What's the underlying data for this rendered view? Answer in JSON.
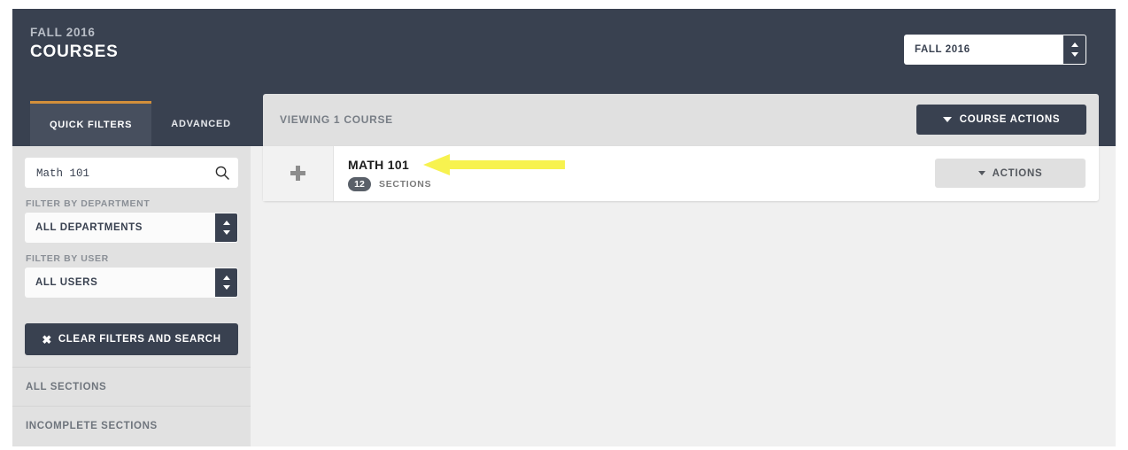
{
  "header": {
    "term_eyebrow": "FALL 2016",
    "page_title": "COURSES",
    "term_select": {
      "value": "FALL 2016",
      "stepper_icon": "stepper-updown-icon"
    },
    "tabs": [
      {
        "label": "QUICK FILTERS",
        "active": true
      },
      {
        "label": "ADVANCED",
        "active": false
      }
    ],
    "accent_color": "#d38f3b",
    "background_color": "#394150"
  },
  "sidebar": {
    "search": {
      "value": "Math 101",
      "placeholder": "Search",
      "icon": "search-icon"
    },
    "department_filter": {
      "label": "FILTER BY DEPARTMENT",
      "value": "ALL DEPARTMENTS"
    },
    "user_filter": {
      "label": "FILTER BY USER",
      "value": "ALL USERS"
    },
    "clear_button": {
      "label": "CLEAR FILTERS AND SEARCH",
      "icon": "close-x-icon",
      "icon_glyph": "✖"
    },
    "items": [
      {
        "label": "ALL SECTIONS"
      },
      {
        "label": "INCOMPLETE SECTIONS"
      }
    ]
  },
  "main": {
    "viewing_text": "VIEWING 1 COURSE",
    "course_actions_button": "COURSE ACTIONS",
    "course": {
      "expand_icon": "plus-icon",
      "name": "MATH 101",
      "section_count": "12",
      "sections_label": "SECTIONS",
      "actions_button": "ACTIONS"
    }
  },
  "annotation": {
    "name": "yellow-pointer-arrow",
    "color": "#f7f24f",
    "direction": "left",
    "points_at": "MATH 101"
  }
}
